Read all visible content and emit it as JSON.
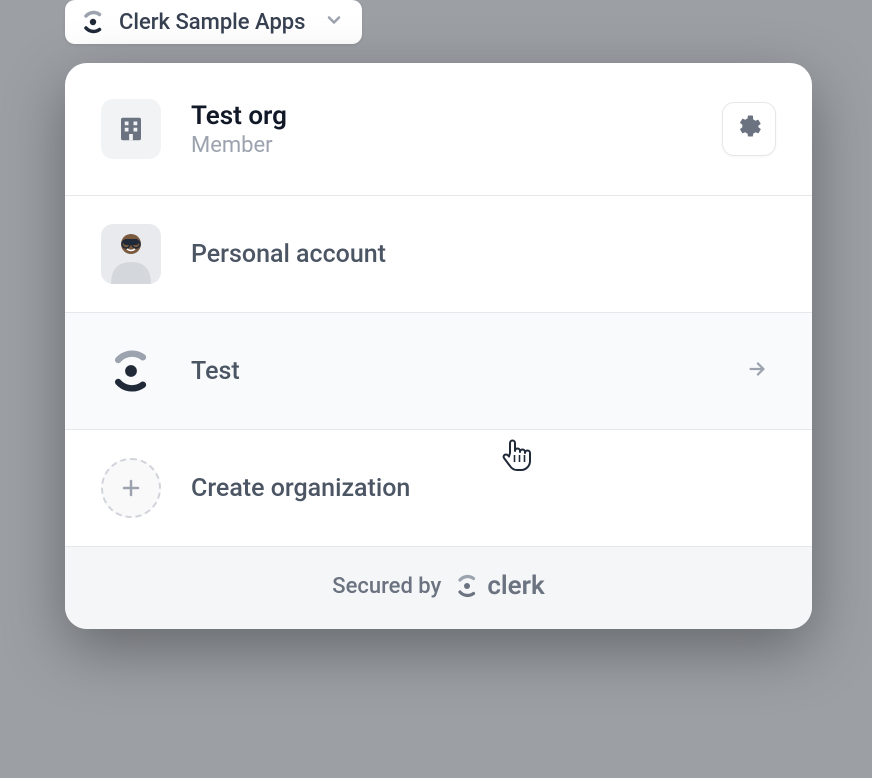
{
  "switcher": {
    "label": "Clerk Sample Apps"
  },
  "current_org": {
    "name": "Test org",
    "role": "Member"
  },
  "items": {
    "personal": "Personal account",
    "org1": "Test",
    "create": "Create organization"
  },
  "footer": {
    "secured_by": "Secured by",
    "brand": "clerk"
  }
}
